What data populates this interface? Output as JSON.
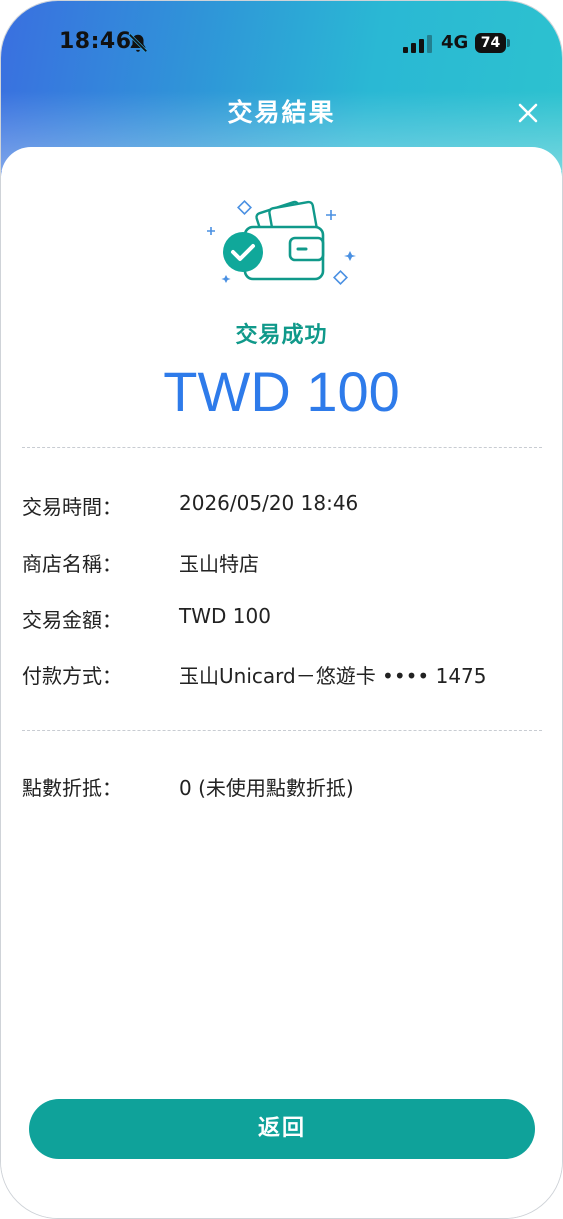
{
  "status_bar": {
    "time": "18:46",
    "network": "4G",
    "battery": "74"
  },
  "nav": {
    "title": "交易結果"
  },
  "result": {
    "status_text": "交易成功",
    "amount": "TWD 100"
  },
  "details": [
    {
      "label": "交易時間：",
      "value": "2026/05/20 18:46"
    },
    {
      "label": "商店名稱：",
      "value": "玉山特店"
    },
    {
      "label": "交易金額：",
      "value": "TWD 100"
    },
    {
      "label": "付款方式：",
      "value": "玉山Unicard－悠遊卡 •••• 1475"
    }
  ],
  "points": {
    "label": "點數折抵：",
    "value": "0 (未使用點數折抵)"
  },
  "actions": {
    "return_label": "返回"
  },
  "colors": {
    "accent_teal": "#10998a",
    "amount_blue": "#2e7bea",
    "button_teal": "#0fa29a"
  },
  "icons": {
    "close": "close-icon",
    "wallet": "wallet-success-icon",
    "mute": "bell-slash-icon",
    "signal": "signal-icon"
  }
}
